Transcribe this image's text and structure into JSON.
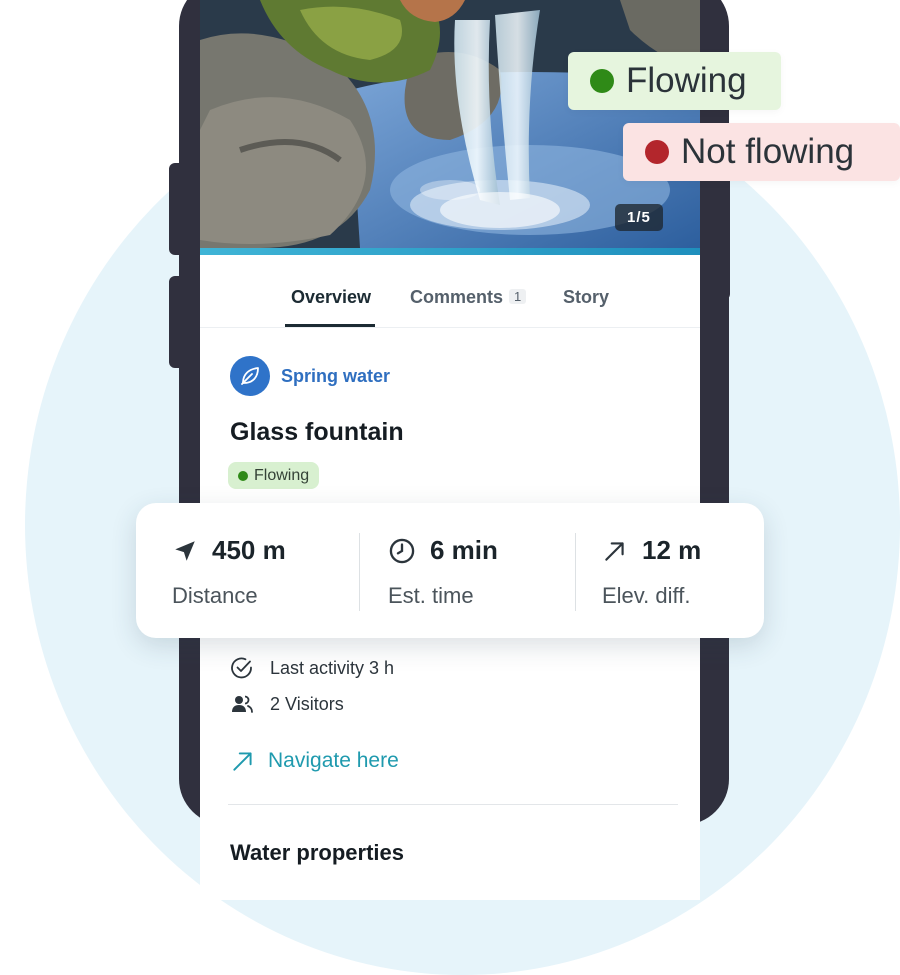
{
  "hero": {
    "photo_counter": "1/5",
    "progress_color": "#3fb4d6"
  },
  "legend": {
    "flowing": {
      "label": "Flowing",
      "color": "#2f8a17"
    },
    "not_flowing": {
      "label": "Not flowing",
      "color": "#b3262c"
    }
  },
  "tabs": {
    "overview": "Overview",
    "comments": "Comments",
    "comments_count": "1",
    "story": "Story",
    "active": "overview"
  },
  "place": {
    "category": "Spring water",
    "category_icon": "leaf-icon",
    "title": "Glass fountain",
    "status": "Flowing"
  },
  "stats": {
    "distance": {
      "value": "450 m",
      "label": "Distance",
      "icon": "navigation-arrow-icon"
    },
    "time": {
      "value": "6 min",
      "label": "Est. time",
      "icon": "clock-icon"
    },
    "elevation": {
      "value": "12 m",
      "label": "Elev. diff.",
      "icon": "arrow-up-right-icon"
    }
  },
  "details": {
    "last_activity": "Last activity 3 h",
    "visitors": "2 Visitors"
  },
  "navigate_label": "Navigate here",
  "section_title": "Water properties",
  "colors": {
    "accent_blue": "#2f73c9",
    "link_teal": "#1f9aae",
    "status_green_bg": "#d8f0d0"
  }
}
